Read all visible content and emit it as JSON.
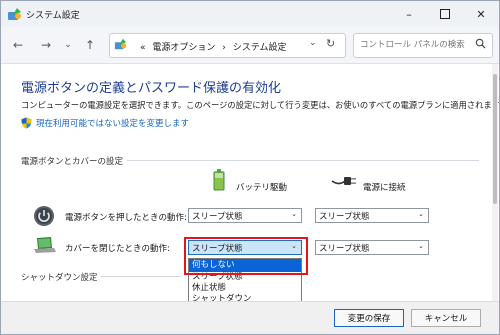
{
  "window": {
    "title": "システム設定",
    "minimize_icon": "minimize-icon",
    "maximize_icon": "maximize-icon",
    "close_icon": "close-icon"
  },
  "nav": {
    "icons": [
      "back-arrow-icon",
      "forward-arrow-icon",
      "recent-dropdown-icon",
      "up-arrow-icon"
    ]
  },
  "address": {
    "prefix": "«",
    "crumb1": "電源オプション",
    "separator": "›",
    "crumb2": "システム設定"
  },
  "search": {
    "placeholder": "コントロール パネルの検索"
  },
  "page": {
    "heading": "電源ボタンの定義とパスワード保護の有効化",
    "description": "コンピューターの電源設定を選択できます。このページの設定に対して行う変更は、お使いのすべての電源プランに適用されます。",
    "admin_link": "現在利用可能ではない設定を変更します",
    "section_buttons": "電源ボタンとカバーの設定",
    "section_shutdown": "シャットダウン設定"
  },
  "columns": {
    "battery": "バッテリ駆動",
    "plugged": "電源に接続"
  },
  "rows": [
    {
      "label": "電源ボタンを押したときの動作:",
      "battery": "スリープ状態",
      "plugged": "スリープ状態"
    },
    {
      "label": "カバーを閉じたときの動作:",
      "battery": "スリープ状態",
      "plugged": "スリープ状態"
    }
  ],
  "dropdown_options": [
    "何もしない",
    "スリープ状態",
    "休止状態",
    "シャットダウン"
  ],
  "buttons": {
    "save": "変更の保存",
    "cancel": "キャンセル"
  },
  "colors": {
    "heading": "#1c3f94",
    "link": "#1565c0",
    "highlight": "#0a64d6",
    "callout": "#e0161e"
  }
}
